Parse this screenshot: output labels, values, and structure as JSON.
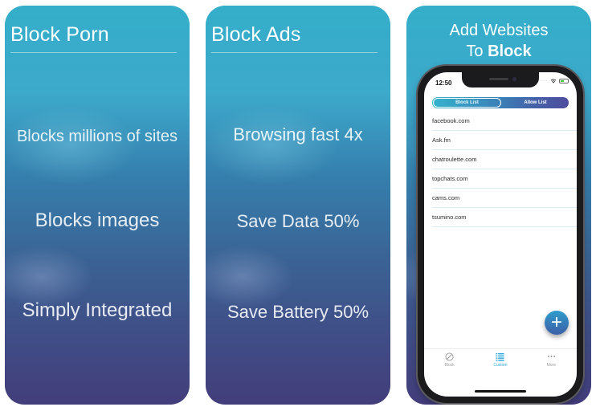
{
  "cards": [
    {
      "title": "Block Porn",
      "features": [
        "Blocks millions of sites",
        "Blocks images",
        "Simply Integrated"
      ]
    },
    {
      "title": "Block Ads",
      "features": [
        "Browsing fast 4x",
        "Save Data 50%",
        "Save Battery 50%"
      ]
    }
  ],
  "showcase": {
    "heading_line1": "Add Websites",
    "heading_line2_prefix": "To ",
    "heading_line2_bold": "Block",
    "phone": {
      "status_time": "12:50",
      "status_icons": [
        "signal-dots",
        "wifi-icon",
        "battery-icon"
      ],
      "segments": [
        {
          "label": "Block List",
          "active": true
        },
        {
          "label": "Allow List",
          "active": false
        }
      ],
      "sites": [
        "facebook.com",
        "Ask.fm",
        "chatroulette.com",
        "topchats.com",
        "cams.com",
        "tsumino.com"
      ],
      "fab_label": "+",
      "tabs": [
        {
          "label": "Block",
          "icon": "prohibited-icon",
          "active": false
        },
        {
          "label": "Custom",
          "icon": "list-icon",
          "active": true
        },
        {
          "label": "More",
          "icon": "more-icon",
          "active": false
        }
      ]
    }
  },
  "colors": {
    "gradient_top": "#34aec9",
    "gradient_mid": "#3a6596",
    "gradient_bottom": "#433d7b",
    "accent_tab": "#2ea7dd",
    "list_divider": "#d6eef4"
  }
}
